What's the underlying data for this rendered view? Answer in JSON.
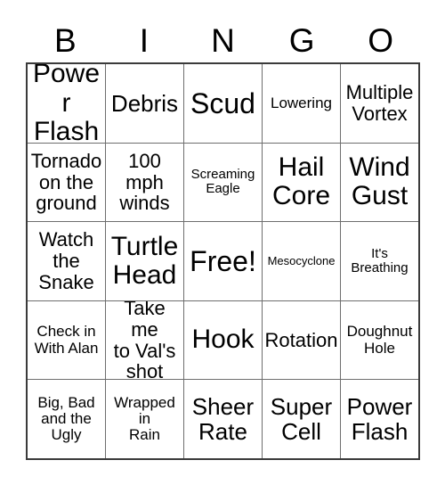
{
  "card": {
    "title_letters": [
      "B",
      "I",
      "N",
      "G",
      "O"
    ],
    "free_space_label": "Free!",
    "colors": {
      "background": "#ffffff",
      "text": "#000000",
      "grid_outer_border": "#3b3b3b",
      "grid_inner_border": "#6e6e6e"
    },
    "rows": [
      [
        {
          "text": "Power\nFlash",
          "size": "xl"
        },
        {
          "text": "Debris",
          "size": "lg"
        },
        {
          "text": "Scud",
          "size": "xxl"
        },
        {
          "text": "Lowering",
          "size": "sm"
        },
        {
          "text": "Multiple\nVortex",
          "size": "md"
        }
      ],
      [
        {
          "text": "Tornado\non the\nground",
          "size": "md"
        },
        {
          "text": "100\nmph\nwinds",
          "size": "md"
        },
        {
          "text": "Screaming\nEagle",
          "size": "xs"
        },
        {
          "text": "Hail\nCore",
          "size": "xl"
        },
        {
          "text": "Wind\nGust",
          "size": "xl"
        }
      ],
      [
        {
          "text": "Watch\nthe\nSnake",
          "size": "md"
        },
        {
          "text": "Turtle\nHead",
          "size": "xl"
        },
        {
          "text": "Free!",
          "size": "xxl"
        },
        {
          "text": "Mesocyclone",
          "size": "xxs"
        },
        {
          "text": "It's\nBreathing",
          "size": "xs"
        }
      ],
      [
        {
          "text": "Check in\nWith Alan",
          "size": "sm"
        },
        {
          "text": "Take me\nto Val's\nshot",
          "size": "md"
        },
        {
          "text": "Hook",
          "size": "xl"
        },
        {
          "text": "Rotation",
          "size": "md"
        },
        {
          "text": "Doughnut\nHole",
          "size": "sm"
        }
      ],
      [
        {
          "text": "Big, Bad\nand the\nUgly",
          "size": "sm"
        },
        {
          "text": "Wrapped\nin\nRain",
          "size": "sm"
        },
        {
          "text": "Sheer\nRate",
          "size": "lg"
        },
        {
          "text": "Super\nCell",
          "size": "lg"
        },
        {
          "text": "Power\nFlash",
          "size": "lg"
        }
      ]
    ]
  }
}
